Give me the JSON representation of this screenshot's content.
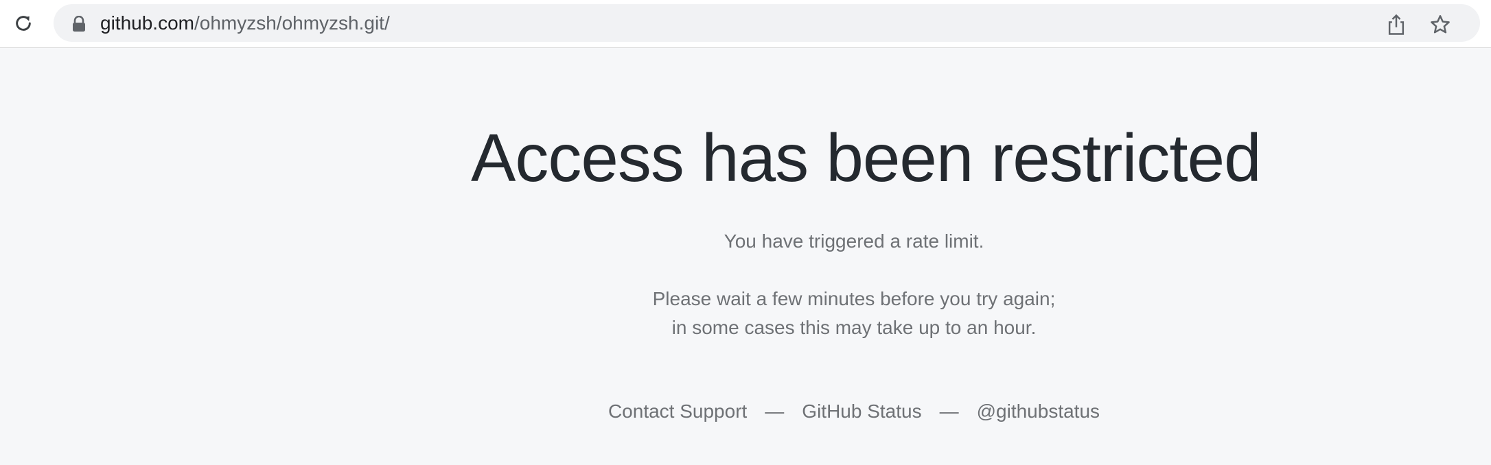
{
  "browser": {
    "url_host": "github.com",
    "url_path": "/ohmyzsh/ohmyzsh.git/",
    "icons": {
      "reload": "reload-icon",
      "lock": "lock-icon",
      "share": "share-icon",
      "bookmark": "star-icon"
    }
  },
  "page": {
    "headline": "Access has been restricted",
    "message_1": "You have triggered a rate limit.",
    "message_2": "Please wait a few minutes before you try again;",
    "message_3": "in some cases this may take up to an hour.",
    "links": {
      "contact": "Contact Support",
      "status": "GitHub Status",
      "twitter": "@githubstatus",
      "separator": "—"
    }
  },
  "colors": {
    "page_background": "#f6f7f9",
    "headline": "#24292f",
    "muted_text": "#6e7175"
  }
}
